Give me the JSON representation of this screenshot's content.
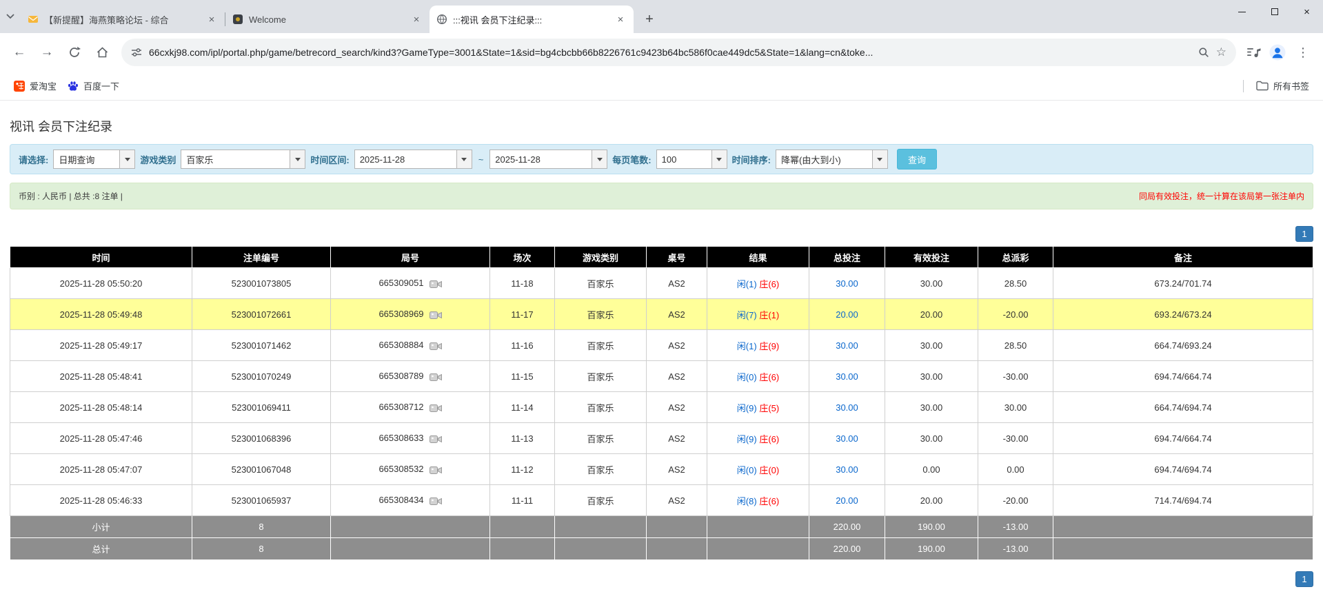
{
  "browser": {
    "tabs": [
      {
        "title": "【新提醒】海燕策略论坛 - 综合",
        "active": false
      },
      {
        "title": "Welcome",
        "active": false
      },
      {
        "title": ":::视讯 会员下注纪录:::",
        "active": true
      }
    ],
    "url": "66cxkj98.com/ipl/portal.php/game/betrecord_search/kind3?GameType=3001&State=1&sid=bg4cbcbb66b8226761c9423b64bc586f0cae449dc5&State=1&lang=cn&toke...",
    "bookmarks": [
      {
        "label": "爱淘宝"
      },
      {
        "label": "百度一下"
      }
    ],
    "all_bookmarks_label": "所有书签"
  },
  "icons": {
    "back": "←",
    "forward": "→",
    "new_tab": "+",
    "close": "×",
    "menu": "⋮",
    "star": "☆"
  },
  "page": {
    "title": "视讯 会员下注纪录",
    "filters": {
      "select_label": "请选择:",
      "select_value": "日期查询",
      "game_type_label": "游戏类别",
      "game_type_value": "百家乐",
      "date_range_label": "时间区间:",
      "date_from": "2025-11-28",
      "date_to": "2025-11-28",
      "range_separator": "~",
      "page_size_label": "每页笔数:",
      "page_size_value": "100",
      "sort_label": "时间排序:",
      "sort_value": "降幂(由大到小)",
      "search_button": "查询"
    },
    "summary": {
      "left": "币别 : 人民币 | 总共 :8 注单 |",
      "right": "同局有效投注，统一计算在该局第一张注单内"
    },
    "pagination": "1",
    "table": {
      "headers": [
        "时间",
        "注单编号",
        "局号",
        "场次",
        "游戏类别",
        "桌号",
        "结果",
        "总投注",
        "有效投注",
        "总派彩",
        "备注"
      ],
      "rows": [
        {
          "time": "2025-11-28 05:50:20",
          "bet_id": "523001073805",
          "round_id": "665309051",
          "session": "11-18",
          "game": "百家乐",
          "table_no": "AS2",
          "result_player": "闲(1)",
          "result_banker": "庄(6)",
          "total_bet": "30.00",
          "valid_bet": "30.00",
          "payout": "28.50",
          "remark": "673.24/701.74",
          "highlighted": false
        },
        {
          "time": "2025-11-28 05:49:48",
          "bet_id": "523001072661",
          "round_id": "665308969",
          "session": "11-17",
          "game": "百家乐",
          "table_no": "AS2",
          "result_player": "闲(7)",
          "result_banker": "庄(1)",
          "total_bet": "20.00",
          "valid_bet": "20.00",
          "payout": "-20.00",
          "remark": "693.24/673.24",
          "highlighted": true
        },
        {
          "time": "2025-11-28 05:49:17",
          "bet_id": "523001071462",
          "round_id": "665308884",
          "session": "11-16",
          "game": "百家乐",
          "table_no": "AS2",
          "result_player": "闲(1)",
          "result_banker": "庄(9)",
          "total_bet": "30.00",
          "valid_bet": "30.00",
          "payout": "28.50",
          "remark": "664.74/693.24",
          "highlighted": false
        },
        {
          "time": "2025-11-28 05:48:41",
          "bet_id": "523001070249",
          "round_id": "665308789",
          "session": "11-15",
          "game": "百家乐",
          "table_no": "AS2",
          "result_player": "闲(0)",
          "result_banker": "庄(6)",
          "total_bet": "30.00",
          "valid_bet": "30.00",
          "payout": "-30.00",
          "remark": "694.74/664.74",
          "highlighted": false
        },
        {
          "time": "2025-11-28 05:48:14",
          "bet_id": "523001069411",
          "round_id": "665308712",
          "session": "11-14",
          "game": "百家乐",
          "table_no": "AS2",
          "result_player": "闲(9)",
          "result_banker": "庄(5)",
          "total_bet": "30.00",
          "valid_bet": "30.00",
          "payout": "30.00",
          "remark": "664.74/694.74",
          "highlighted": false
        },
        {
          "time": "2025-11-28 05:47:46",
          "bet_id": "523001068396",
          "round_id": "665308633",
          "session": "11-13",
          "game": "百家乐",
          "table_no": "AS2",
          "result_player": "闲(9)",
          "result_banker": "庄(6)",
          "total_bet": "30.00",
          "valid_bet": "30.00",
          "payout": "-30.00",
          "remark": "694.74/664.74",
          "highlighted": false
        },
        {
          "time": "2025-11-28 05:47:07",
          "bet_id": "523001067048",
          "round_id": "665308532",
          "session": "11-12",
          "game": "百家乐",
          "table_no": "AS2",
          "result_player": "闲(0)",
          "result_banker": "庄(0)",
          "total_bet": "30.00",
          "valid_bet": "0.00",
          "payout": "0.00",
          "remark": "694.74/694.74",
          "highlighted": false
        },
        {
          "time": "2025-11-28 05:46:33",
          "bet_id": "523001065937",
          "round_id": "665308434",
          "session": "11-11",
          "game": "百家乐",
          "table_no": "AS2",
          "result_player": "闲(8)",
          "result_banker": "庄(6)",
          "total_bet": "20.00",
          "valid_bet": "20.00",
          "payout": "-20.00",
          "remark": "714.74/694.74",
          "highlighted": false
        }
      ],
      "footer_rows": [
        {
          "label": "小计",
          "count": "8",
          "total_bet": "220.00",
          "valid_bet": "190.00",
          "payout": "-13.00"
        },
        {
          "label": "总计",
          "count": "8",
          "total_bet": "220.00",
          "valid_bet": "190.00",
          "payout": "-13.00"
        }
      ]
    }
  },
  "colors": {
    "accent_blue": "#337ab7",
    "link_blue": "#0966cc",
    "negative_red": "#ff0000",
    "highlight_yellow": "#ffff99",
    "filter_bg": "#d9edf7",
    "summary_bg": "#dff0d8",
    "table_header_bg": "#000000",
    "table_footer_bg": "#8e8e8e",
    "search_button_bg": "#5bc0de"
  }
}
